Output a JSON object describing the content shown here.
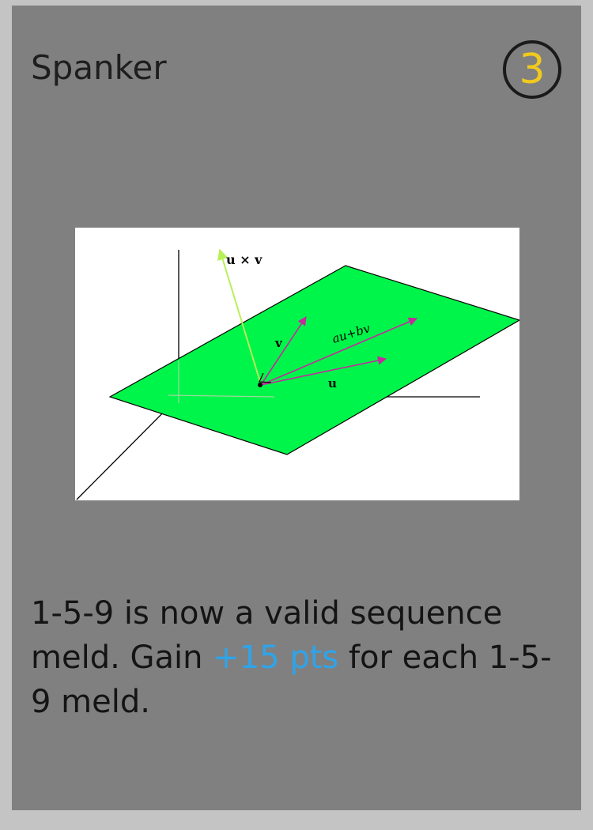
{
  "card": {
    "title": "Spanker",
    "cost": "3",
    "art": {
      "label_cross": "u × v",
      "label_v": "v",
      "label_combo": "au+bv",
      "label_u": "u"
    },
    "rules": {
      "part1": "1-5-9 is now a valid sequence meld. Gain ",
      "highlight": "+15 pts",
      "part2": " for each 1-5-9 meld."
    }
  },
  "colors": {
    "card_background": "#808080",
    "page_background": "#c4c4c4",
    "cost_number": "#f0c91e",
    "highlight_text": "#2ea4ea",
    "plane": "#00f54a",
    "vector_arrow": "#c32a9e",
    "cross_product_arrow": "#b8f05a"
  }
}
